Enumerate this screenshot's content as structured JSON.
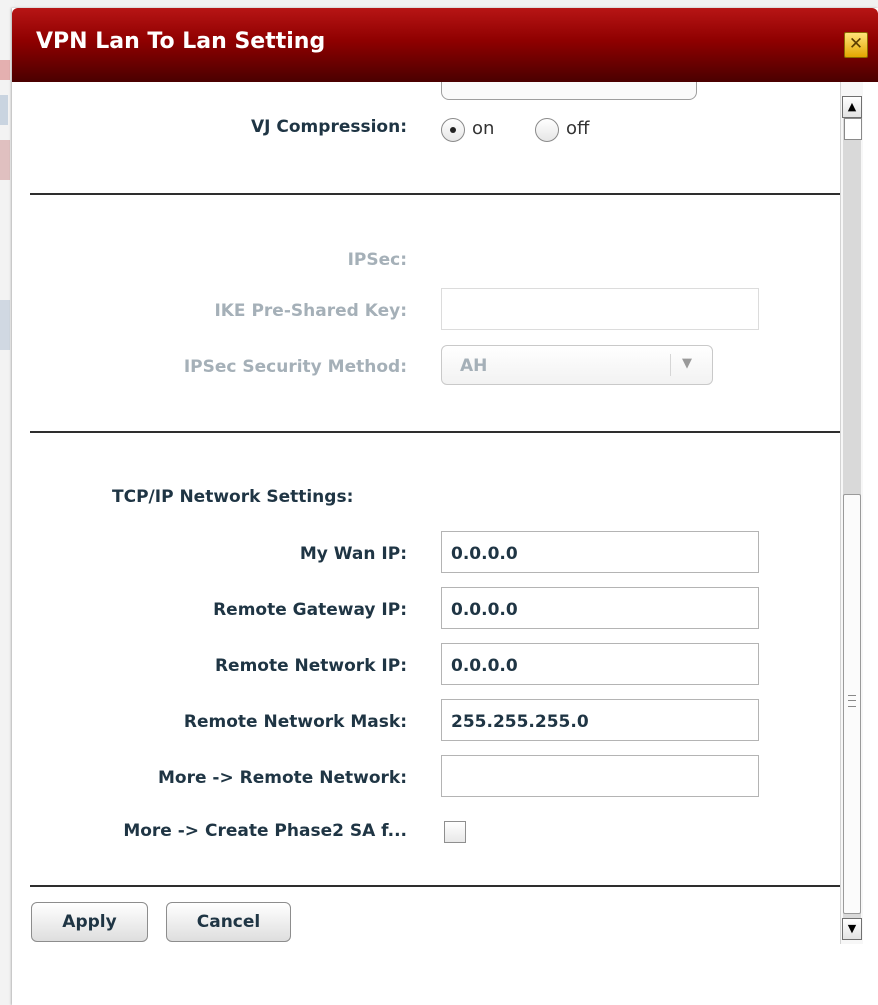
{
  "dialog": {
    "title": "VPN Lan To Lan Setting",
    "close_glyph": "✕"
  },
  "vj": {
    "label": "VJ Compression:",
    "on_label": "on",
    "off_label": "off",
    "selected": "on"
  },
  "ipsec": {
    "heading": "IPSec:",
    "ike_label": "IKE Pre-Shared Key:",
    "ike_value": "",
    "method_label": "IPSec Security Method:",
    "method_value": "AH",
    "method_arrow": "▼"
  },
  "tcpip": {
    "heading": "TCP/IP Network Settings:",
    "fields": [
      {
        "label": "My Wan IP:",
        "value": "0.0.0.0"
      },
      {
        "label": "Remote Gateway IP:",
        "value": "0.0.0.0"
      },
      {
        "label": "Remote Network IP:",
        "value": "0.0.0.0"
      },
      {
        "label": "Remote Network Mask:",
        "value": "255.255.255.0"
      },
      {
        "label": "More -> Remote Network:",
        "value": ""
      }
    ],
    "phase2_label": "More -> Create Phase2 SA f...",
    "phase2_checked": false
  },
  "buttons": {
    "apply": "Apply",
    "cancel": "Cancel"
  },
  "scrollbar": {
    "up_glyph": "▲",
    "down_glyph": "▼"
  },
  "colors": {
    "title_bar": "#8e0000",
    "label_text": "#1f3544",
    "disabled_text": "#a5b0b8"
  }
}
